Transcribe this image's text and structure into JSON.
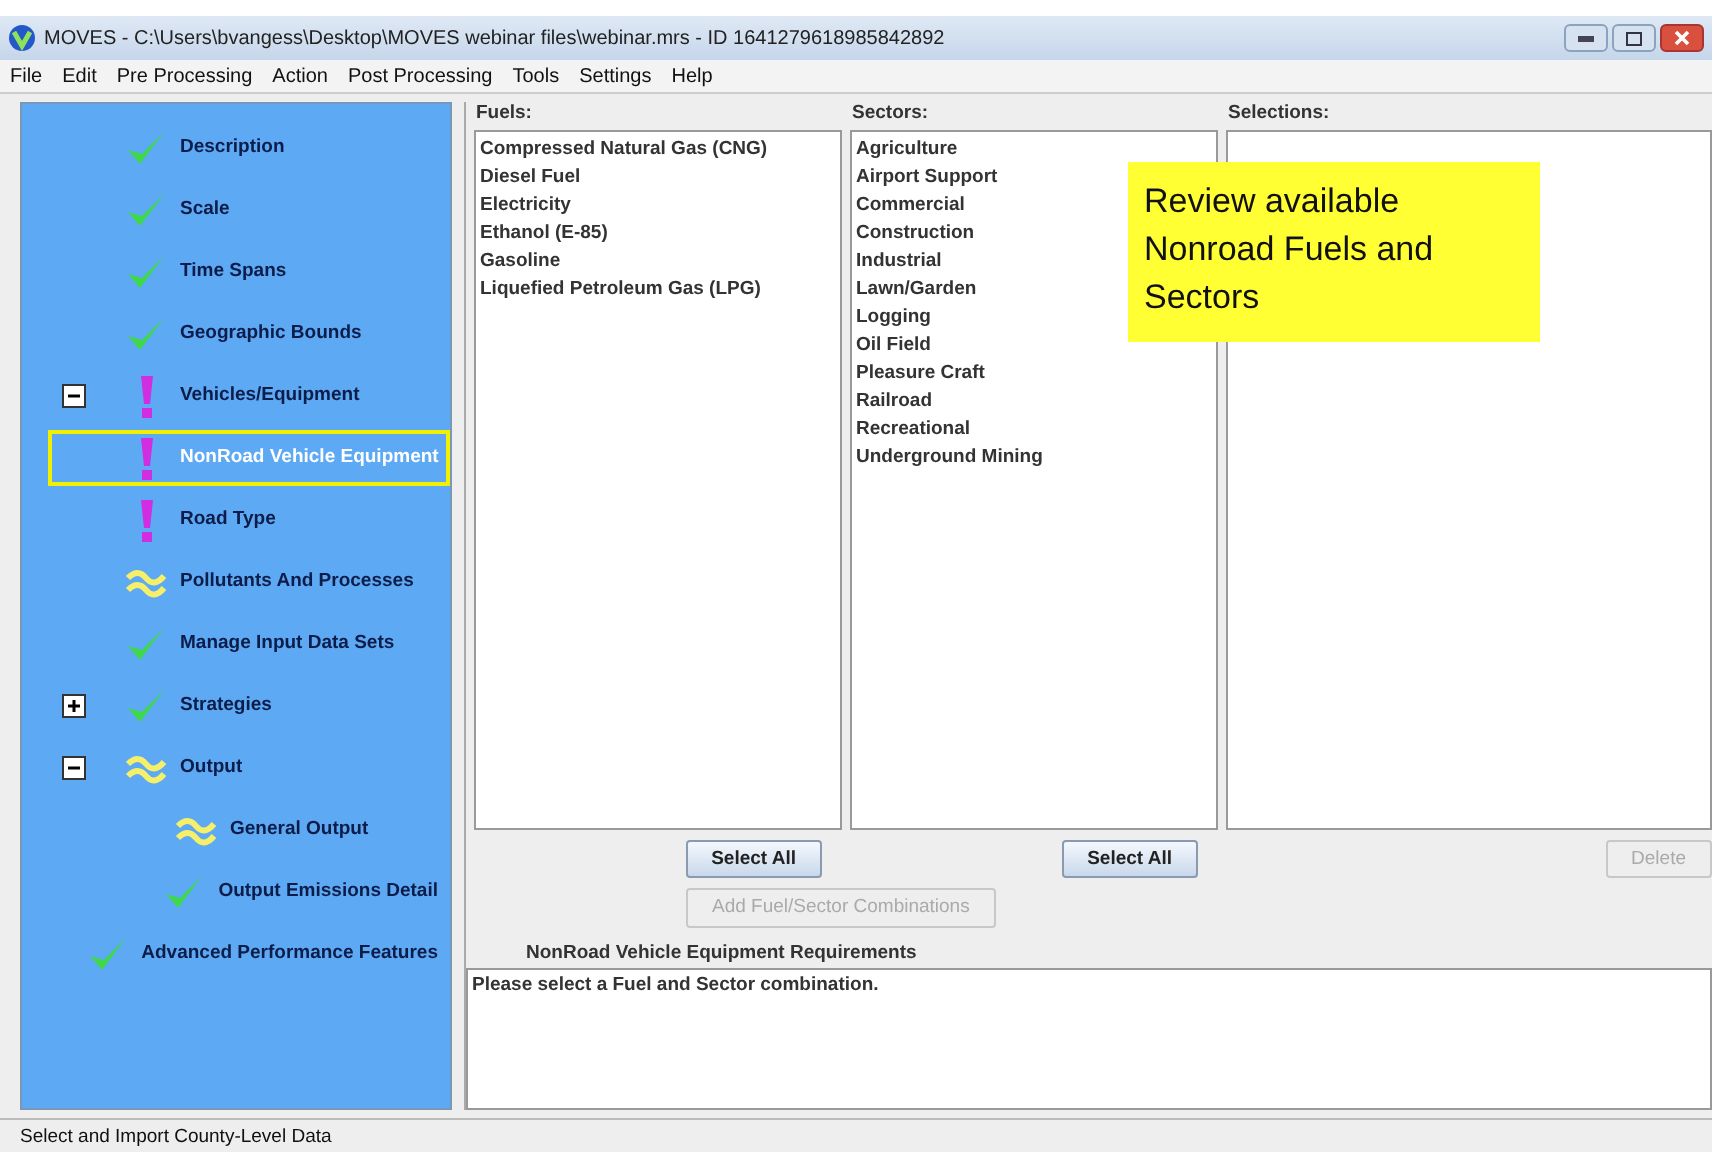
{
  "window": {
    "title": "MOVES - C:\\Users\\bvangess\\Desktop\\MOVES webinar files\\webinar.mrs - ID 1641279618985842892"
  },
  "menu": [
    "File",
    "Edit",
    "Pre Processing",
    "Action",
    "Post Processing",
    "Tools",
    "Settings",
    "Help"
  ],
  "navigation": [
    {
      "label": "Description",
      "kind": "check",
      "selected": false
    },
    {
      "label": "Scale",
      "kind": "check",
      "selected": false
    },
    {
      "label": "Time Spans",
      "kind": "check",
      "selected": false
    },
    {
      "label": "Geographic Bounds",
      "kind": "check",
      "selected": false
    },
    {
      "label": "Vehicles/Equipment",
      "kind": "exclaim",
      "selected": false,
      "expanded": true,
      "children": [
        {
          "label": "NonRoad Vehicle Equipment",
          "kind": "exclaim",
          "selected": true
        }
      ]
    },
    {
      "label": "Road Type",
      "kind": "exclaim",
      "selected": false
    },
    {
      "label": "Pollutants And Processes",
      "kind": "approx",
      "selected": false
    },
    {
      "label": "Manage Input Data Sets",
      "kind": "check",
      "selected": false
    },
    {
      "label": "Strategies",
      "kind": "check",
      "selected": false,
      "expanded": false
    },
    {
      "label": "Output",
      "kind": "approx",
      "selected": false,
      "expanded": true,
      "children": [
        {
          "label": "General Output",
          "kind": "approx",
          "selected": false
        },
        {
          "label": "Output Emissions Detail",
          "kind": "check",
          "selected": false
        }
      ]
    },
    {
      "label": "Advanced Performance Features",
      "kind": "check",
      "selected": false
    }
  ],
  "fuels": {
    "label": "Fuels:",
    "items": [
      "Compressed Natural Gas (CNG)",
      "Diesel Fuel",
      "Electricity",
      "Ethanol (E-85)",
      "Gasoline",
      "Liquefied Petroleum Gas (LPG)"
    ],
    "button": {
      "label": "Select All",
      "disabled": false
    }
  },
  "sectors": {
    "label": "Sectors:",
    "items": [
      "Agriculture",
      "Airport Support",
      "Commercial",
      "Construction",
      "Industrial",
      "Lawn/Garden",
      "Logging",
      "Oil Field",
      "Pleasure Craft",
      "Railroad",
      "Recreational",
      "Underground Mining"
    ],
    "button": {
      "label": "Select All",
      "disabled": false
    }
  },
  "selections": {
    "label": "Selections:",
    "button": {
      "label": "Delete",
      "disabled": true
    }
  },
  "add_button": {
    "label": "Add Fuel/Sector Combinations",
    "disabled": true
  },
  "requirements": {
    "label": "NonRoad Vehicle Equipment Requirements",
    "text": "Please select a Fuel and Sector combination."
  },
  "callout": "Review available Nonroad Fuels and Sectors",
  "status_bar": "Select and Import County-Level Data"
}
